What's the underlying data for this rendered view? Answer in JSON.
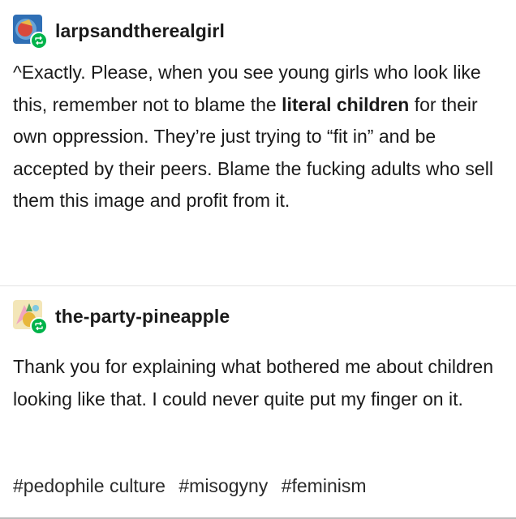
{
  "posts": [
    {
      "username": "larpsandtherealgirl",
      "avatar_icon": "avatar-blue-red",
      "badge_icon": "reblog-icon",
      "badge_color": "#00b34a",
      "text": {
        "part1": "^Exactly. Please, when you see young girls who look like this, remember not to blame the ",
        "bold": "literal children",
        "part2": " for their own oppression. They’re just trying to “fit in” and be accepted by their peers. Blame the fucking adults who sell them this image and profit from it."
      }
    },
    {
      "username": "the-party-pineapple",
      "avatar_icon": "avatar-pineapple",
      "badge_icon": "reblog-icon",
      "badge_color": "#00b34a",
      "text": "Thank you for explaining what bothered me about children looking like that. I could never quite put my finger on it."
    }
  ],
  "tags": [
    "#pedophile culture",
    "#misogyny",
    "#feminism"
  ]
}
